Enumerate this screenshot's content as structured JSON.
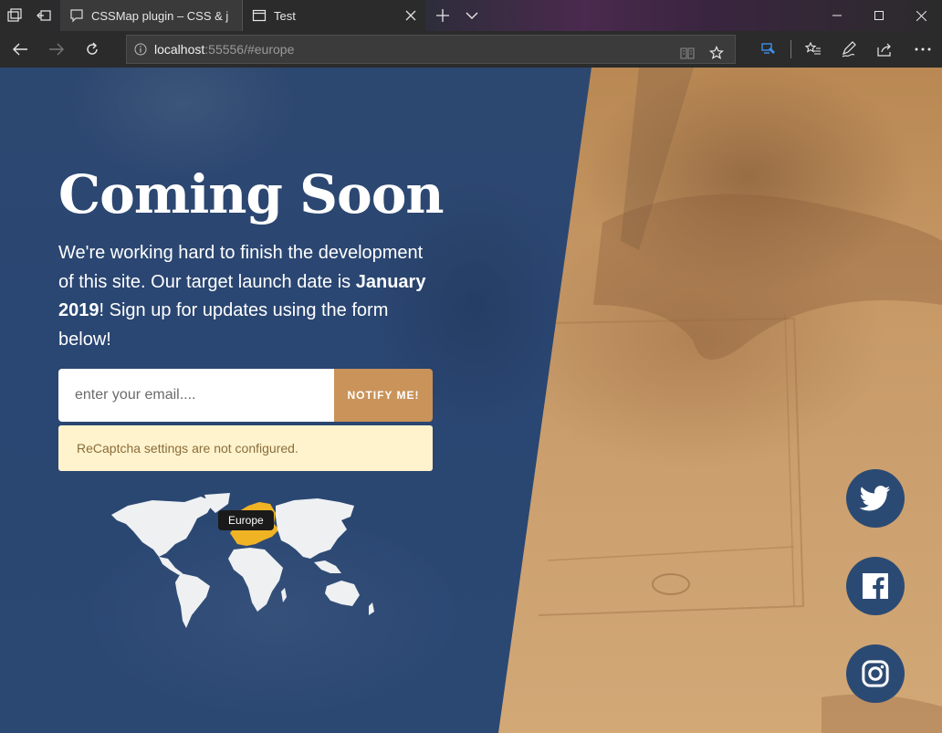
{
  "browser": {
    "tabs": [
      {
        "title": "CSSMap plugin – CSS & jQu",
        "active": false
      },
      {
        "title": "Test",
        "active": true
      }
    ],
    "url": {
      "host": "localhost",
      "rest": ":55556/#europe"
    }
  },
  "page": {
    "title": "Coming Soon",
    "lead": {
      "part1": "We're working hard to finish the development of this site. Our target launch date is ",
      "date": "January 2019",
      "part2": "! Sign up for updates using the form below!"
    },
    "form": {
      "email_placeholder": "enter your email....",
      "button_label": "NOTIFY ME!"
    },
    "alert": "ReCaptcha settings are not configured.",
    "map": {
      "tooltip": "Europe",
      "highlight_color": "#f0b323",
      "land_color": "#eef0f2"
    },
    "social": [
      "twitter-icon",
      "facebook-icon",
      "instagram-icon"
    ],
    "colors": {
      "primary_dark": "#2b4a73",
      "accent": "#c9935a",
      "alert_bg": "#fff3cd",
      "alert_text": "#8a6d3b"
    }
  }
}
